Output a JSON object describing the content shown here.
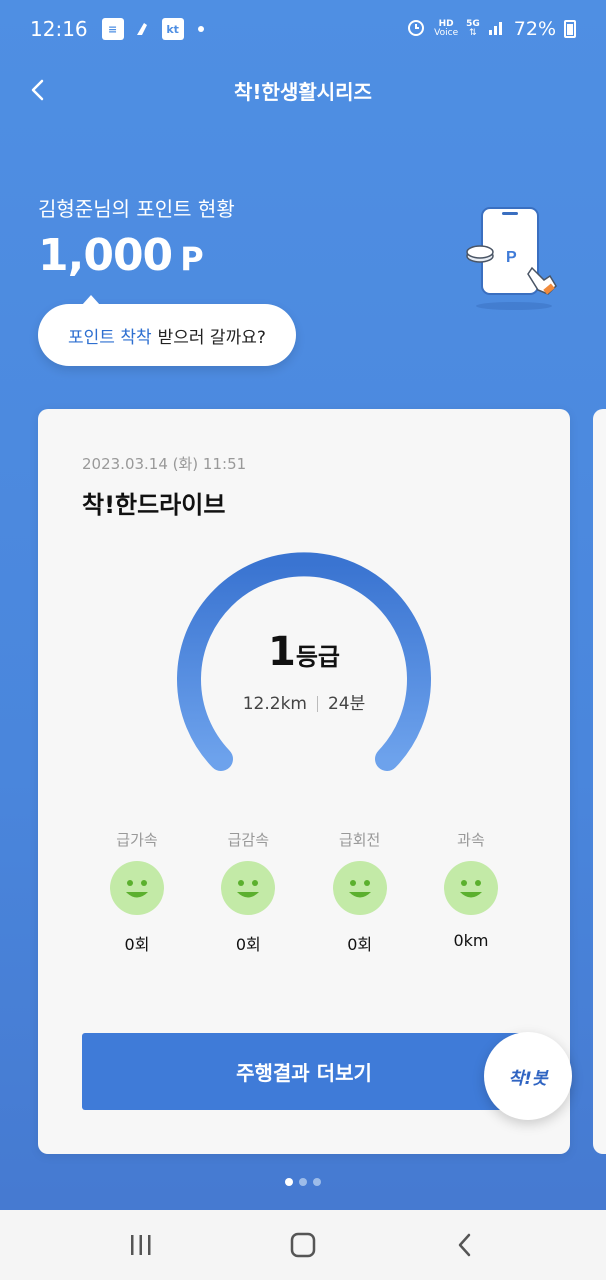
{
  "status_bar": {
    "time": "12:16",
    "battery": "72%",
    "network": "5G",
    "volte_label": "Voice"
  },
  "header": {
    "title": "착!한생활시리즈"
  },
  "points": {
    "label": "김형준님의 포인트 현황",
    "value": "1,000",
    "unit": "P"
  },
  "promo_bubble": {
    "accent_text": "포인트 착착",
    "text": "받으러 갈까요?"
  },
  "card": {
    "date": "2023.03.14 (화) 11:51",
    "title": "착!한드라이브",
    "grade_number": "1",
    "grade_suffix": "등급",
    "distance": "12.2km",
    "duration": "24분",
    "metrics": [
      {
        "label": "급가속",
        "value": "0회"
      },
      {
        "label": "급감속",
        "value": "0회"
      },
      {
        "label": "급회전",
        "value": "0회"
      },
      {
        "label": "과속",
        "value": "0km"
      }
    ],
    "more_button": "주행결과 더보기"
  },
  "chatbot": {
    "label": "착!봇"
  },
  "pager": {
    "count": 3,
    "active": 1
  },
  "colors": {
    "background": "#4f8fe3",
    "accent": "#3f7bd8",
    "face": "#c3eaa7"
  }
}
